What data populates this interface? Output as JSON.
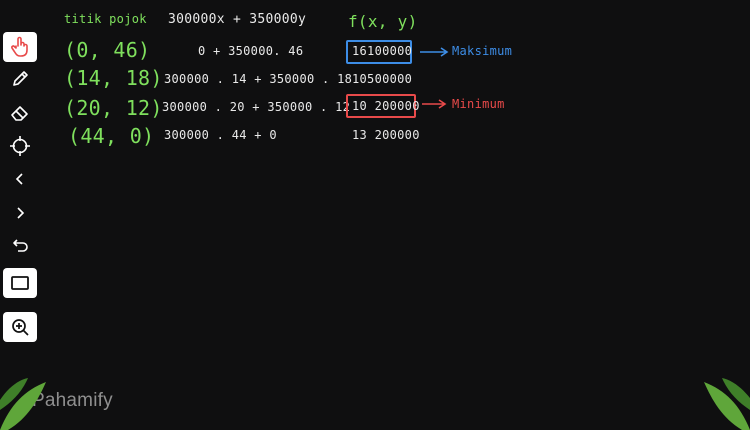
{
  "tools": [
    {
      "name": "hand-pointer-icon"
    },
    {
      "name": "pencil-icon"
    },
    {
      "name": "eraser-icon"
    },
    {
      "name": "crosshair-icon"
    },
    {
      "name": "chevron-left-icon"
    },
    {
      "name": "chevron-right-icon"
    },
    {
      "name": "undo-icon"
    },
    {
      "name": "rectangle-icon"
    },
    {
      "name": "zoom-in-icon"
    }
  ],
  "notes": {
    "col1_header": "titik pojok",
    "col1_rows": [
      "(0, 46)",
      "(14, 18)",
      "(20, 12)",
      "(44, 0)"
    ],
    "col2_header": "300000x + 350000y",
    "col2_rows": [
      "0    + 350000. 46",
      "300000 . 14 + 350000 . 18",
      "300000 . 20 + 350000 . 12",
      "300000 . 44 +      0"
    ],
    "col3_header": "f(x, y)",
    "col3_rows": [
      "16100000",
      "10500000",
      "10 200000",
      "13 200000"
    ],
    "max_label": "Maksimum",
    "min_label": "Minimum"
  },
  "logo": "Pahamify",
  "colors": {
    "handwriting": "#7fe05d",
    "values": "#e9e9e9",
    "max_box": "#3d8de6",
    "min_box": "#e84a4a",
    "background": "#0f0f10"
  }
}
